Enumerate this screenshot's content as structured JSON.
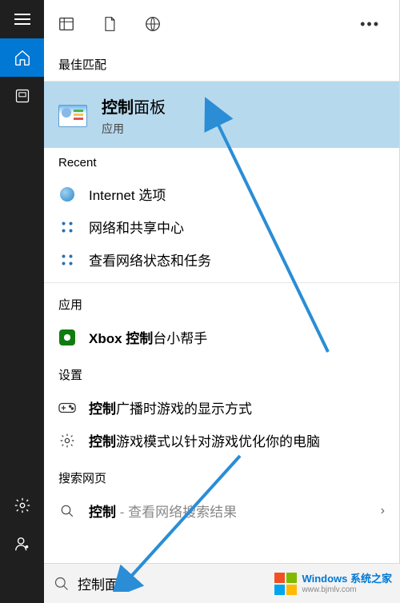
{
  "sections": {
    "best_match_header": "最佳匹配",
    "recent_header": "Recent",
    "apps_header": "应用",
    "settings_header": "设置",
    "web_header": "搜索网页"
  },
  "best_match": {
    "title_bold": "控制",
    "title_rest": "面板",
    "subtitle": "应用"
  },
  "recent": [
    {
      "icon": "internet",
      "label": "Internet 选项"
    },
    {
      "icon": "network",
      "label": "网络和共享中心"
    },
    {
      "icon": "network",
      "label": "查看网络状态和任务"
    }
  ],
  "apps": [
    {
      "icon": "xbox",
      "bold": "Xbox 控制",
      "rest": "台小帮手"
    }
  ],
  "settings": [
    {
      "icon": "controller",
      "bold": "控制",
      "rest": "广播时游戏的显示方式"
    },
    {
      "icon": "gear",
      "bold": "控制",
      "rest": "游戏模式以针对游戏优化你的电脑"
    }
  ],
  "web": [
    {
      "icon": "search",
      "bold": "控制",
      "hint": " - 查看网络搜索结果",
      "has_chevron": true
    }
  ],
  "search": {
    "text": "控制面板"
  },
  "watermark": {
    "line1": "Windows 系统之家",
    "line2": "www.bjmlv.com"
  }
}
